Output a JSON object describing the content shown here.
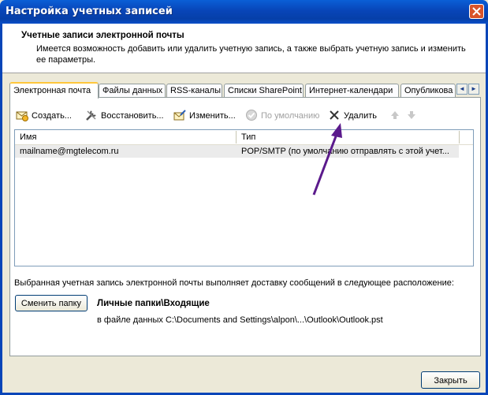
{
  "window": {
    "title": "Настройка учетных записей"
  },
  "header": {
    "title": "Учетные записи электронной почты",
    "description": "Имеется возможность добавить или удалить учетную запись, а также выбрать учетную запись и изменить ее параметры."
  },
  "tabs": [
    {
      "label": "Электронная почта",
      "active": true
    },
    {
      "label": "Файлы данных"
    },
    {
      "label": "RSS-каналы"
    },
    {
      "label": "Списки SharePoint"
    },
    {
      "label": "Интернет-календари"
    },
    {
      "label": "Опубликова"
    }
  ],
  "tab_scroll": {
    "left": "◄",
    "right": "►"
  },
  "toolbar": {
    "create": "Создать...",
    "restore": "Восстановить...",
    "change": "Изменить...",
    "default": "По умолчанию",
    "delete": "Удалить"
  },
  "table": {
    "columns": [
      "Имя",
      "Тип"
    ],
    "rows": [
      {
        "name": "mailname@mgtelecom.ru",
        "type": "POP/SMTP (по умолчанию отправлять с этой учет..."
      }
    ]
  },
  "delivery": {
    "text": "Выбранная учетная запись электронной почты выполняет доставку сообщений в следующее расположение:",
    "change_folder_button": "Сменить папку",
    "folder": "Личные папки\\Входящие",
    "path": "в файле данных C:\\Documents and Settings\\alpon\\...\\Outlook\\Outlook.pst"
  },
  "footer": {
    "close_button": "Закрыть"
  },
  "colors": {
    "titlebar": "#0845b8",
    "annotation_arrow": "#5b1a8c",
    "tab_highlight": "#ffc73c"
  }
}
